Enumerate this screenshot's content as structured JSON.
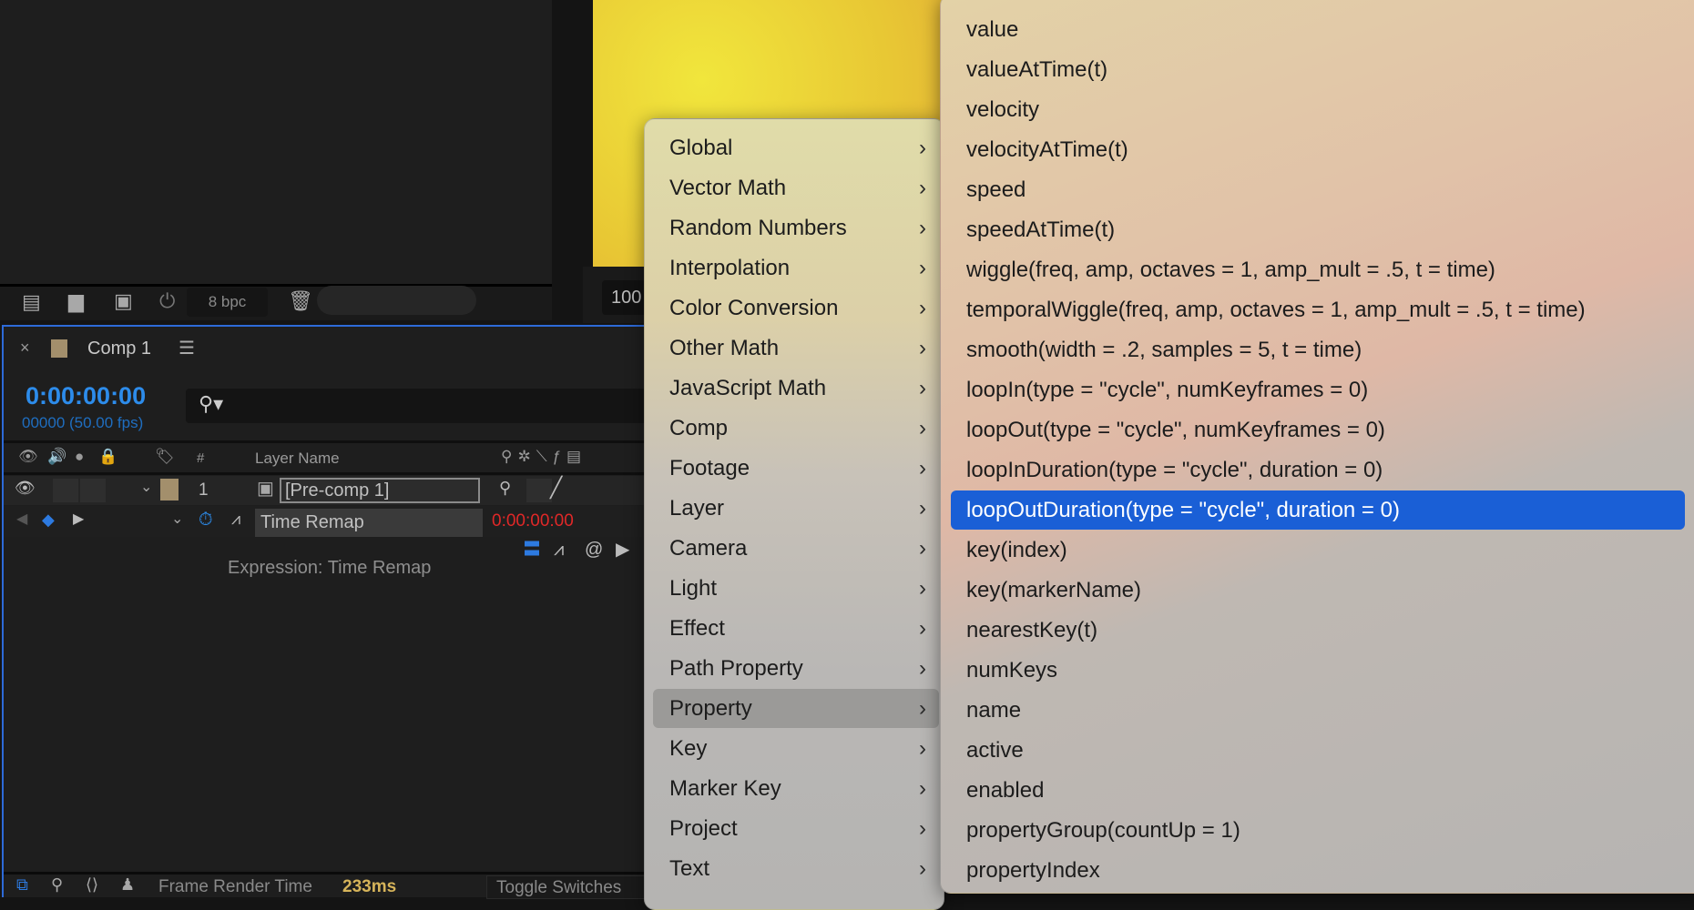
{
  "project_panel": {
    "bit_depth": "8 bpc",
    "zoom_value": "100"
  },
  "timeline": {
    "tab_title": "Comp 1",
    "timecode": "0:00:00:00",
    "frame_info": "00000 (50.00 fps)",
    "columns": {
      "number": "#",
      "layer_name": "Layer Name"
    },
    "layer": {
      "index": "1",
      "name": "[Pre-comp 1]",
      "label_color": "#a38f6c"
    },
    "property": {
      "name": "Time Remap",
      "value": "0:00:00:00"
    },
    "expression_label": "Expression: Time Remap",
    "footer": {
      "frame_render_label": "Frame Render Time",
      "frame_render_value": "233ms",
      "toggle_label": "Toggle Switches"
    }
  },
  "menu": {
    "items": [
      "Global",
      "Vector Math",
      "Random Numbers",
      "Interpolation",
      "Color Conversion",
      "Other Math",
      "JavaScript Math",
      "Comp",
      "Footage",
      "Layer",
      "Camera",
      "Light",
      "Effect",
      "Path Property",
      "Property",
      "Key",
      "Marker Key",
      "Project",
      "Text"
    ],
    "selected": "Property"
  },
  "submenu": {
    "items": [
      "value",
      "valueAtTime(t)",
      "velocity",
      "velocityAtTime(t)",
      "speed",
      "speedAtTime(t)",
      "wiggle(freq, amp, octaves = 1, amp_mult = .5, t = time)",
      "temporalWiggle(freq, amp, octaves = 1, amp_mult = .5, t = time)",
      "smooth(width = .2, samples = 5, t = time)",
      "loopIn(type = \"cycle\", numKeyframes = 0)",
      "loopOut(type = \"cycle\", numKeyframes = 0)",
      "loopInDuration(type = \"cycle\", duration = 0)",
      "loopOutDuration(type = \"cycle\", duration = 0)",
      "key(index)",
      "key(markerName)",
      "nearestKey(t)",
      "numKeys",
      "name",
      "active",
      "enabled",
      "propertyGroup(countUp = 1)",
      "propertyIndex"
    ],
    "selected": "loopOutDuration(type = \"cycle\", duration = 0)"
  },
  "colors": {
    "accent": "#2d8ceb",
    "highlight": "#1a5fd6",
    "timecode_red": "#e02828",
    "render_time": "#d6b45a"
  }
}
